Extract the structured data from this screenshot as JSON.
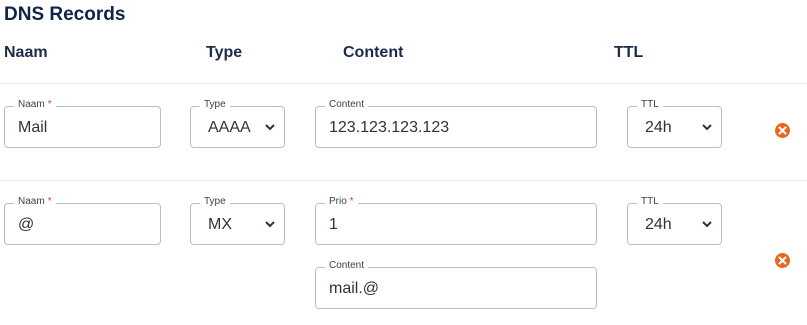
{
  "section": {
    "title": "DNS Records"
  },
  "headers": {
    "naam": "Naam",
    "type": "Type",
    "content": "Content",
    "ttl": "TTL"
  },
  "required_marker": "*",
  "records": [
    {
      "naam_label": "Naam",
      "naam_value": "Mail",
      "type_label": "Type",
      "type_value": "AAAA",
      "content_label": "Content",
      "content_value": "123.123.123.123",
      "ttl_label": "TTL",
      "ttl_value": "24h"
    },
    {
      "naam_label": "Naam",
      "naam_value": "@",
      "type_label": "Type",
      "type_value": "MX",
      "prio_label": "Prio",
      "prio_value": "1",
      "content_label": "Content",
      "content_value": "mail.@",
      "ttl_label": "TTL",
      "ttl_value": "24h"
    }
  ],
  "icons": {
    "delete": "delete-circle-x-icon",
    "select": "chevron-down-icon"
  },
  "colors": {
    "accent": "#e8671f",
    "heading": "#0f2447",
    "required": "#e03b3b"
  }
}
